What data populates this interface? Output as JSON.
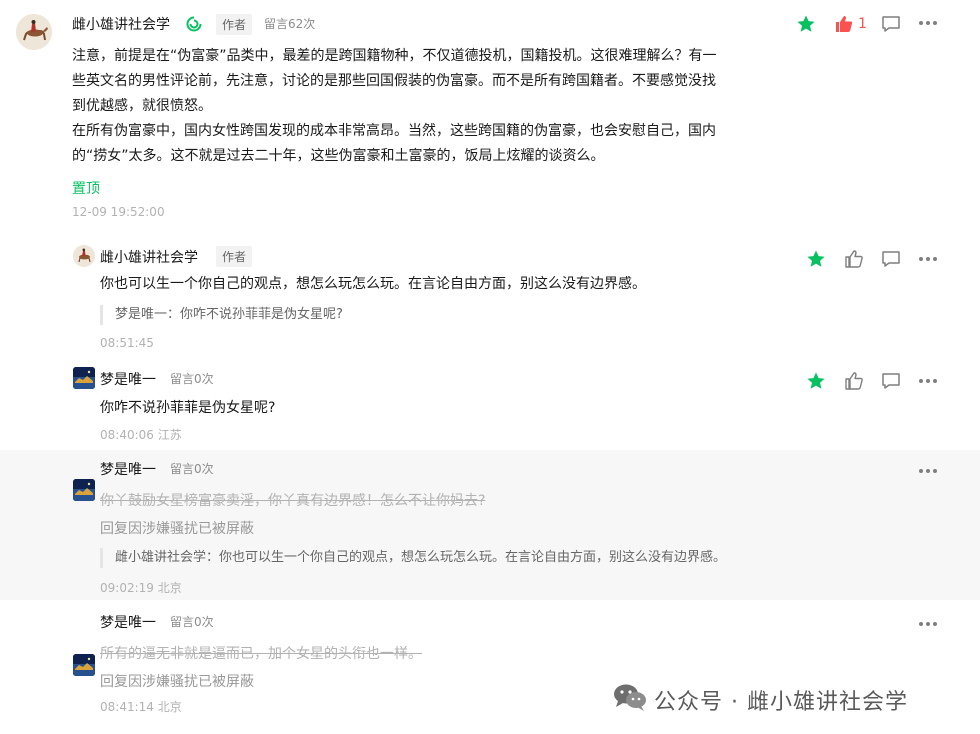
{
  "comments": [
    {
      "author": "雌小雄讲社会学",
      "author_tag": "作者",
      "message_count": "留言62次",
      "body_lines": [
        "注意，前提是在“伪富豪”品类中，最差的是跨国籍物种，不仅道德投机，国籍投机。这很难理解么？有一",
        "些英文名的男性评论前，先注意，讨论的是那些回国假装的伪富豪。而不是所有跨国籍者。不要感觉没找",
        "到优越感，就很愤怒。",
        "在所有伪富豪中，国内女性跨国发现的成本非常高昂。当然，这些跨国籍的伪富豪，也会安慰自己，国内",
        "的“捞女”太多。这不就是过去二十年，这些伪富豪和土富豪的，饭局上炫耀的谈资么。"
      ],
      "pinned_label": "置顶",
      "timestamp": "12-09 19:52:00",
      "like_count": "1"
    }
  ],
  "replies": [
    {
      "author": "雌小雄讲社会学",
      "author_tag": "作者",
      "text": "你也可以生一个你自己的观点，想怎么玩怎么玩。在言论自由方面，别这么没有边界感。",
      "quote": "梦是唯一：你咋不说孙菲菲是伪女星呢?",
      "timestamp": "08:51:45"
    },
    {
      "author": "梦是唯一",
      "message_count": "留言0次",
      "text": "你咋不说孙菲菲是伪女星呢?",
      "timestamp": "08:40:06 江苏"
    },
    {
      "author": "梦是唯一",
      "message_count": "留言0次",
      "struck_text": "你丫鼓励女星榜富豪卖淫，你丫真有边界感！怎么不让你妈去?",
      "blocked_notice": "回复因涉嫌骚扰已被屏蔽",
      "quote": "雌小雄讲社会学：你也可以生一个你自己的观点，想怎么玩怎么玩。在言论自由方面，别这么没有边界感。",
      "timestamp": "09:02:19 北京"
    },
    {
      "author": "梦是唯一",
      "message_count": "留言0次",
      "struck_text": "所有的逼无非就是逼而已，加个女星的头衔也一样。",
      "blocked_notice": "回复因涉嫌骚扰已被屏蔽",
      "timestamp": "08:41:14 北京"
    }
  ],
  "watermark": {
    "prefix": "公众号 · ",
    "account": "雌小雄讲社会学"
  },
  "colors": {
    "star": "#07c160",
    "liked": "#fa5151",
    "pinned": "#07c160",
    "icon_grey": "#7f7f7f"
  },
  "icons": [
    "star-icon",
    "thumbs-up-icon",
    "comment-icon",
    "more-icon",
    "verified-icon",
    "wechat-icon"
  ]
}
